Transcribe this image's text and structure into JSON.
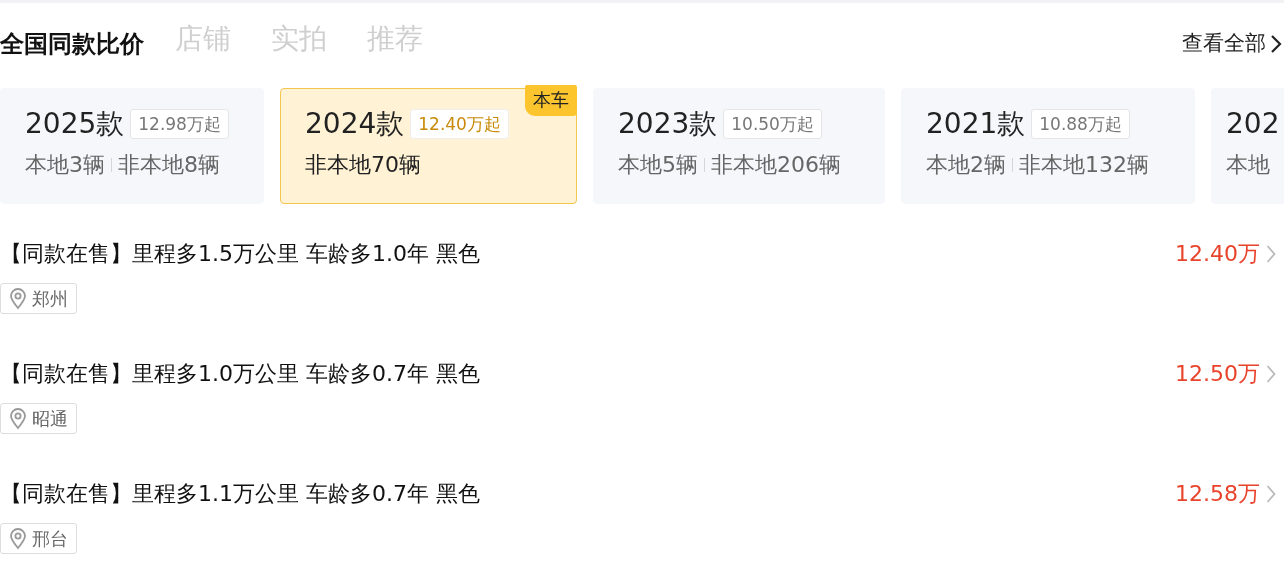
{
  "tabs": [
    {
      "label": "店铺"
    },
    {
      "label": "实拍"
    },
    {
      "label": "推荐"
    }
  ],
  "header": {
    "title": "全国同款比价",
    "view_all": "查看全部"
  },
  "versions": [
    {
      "year": "2025款",
      "price": "12.98万起",
      "stats": [
        "本地3辆",
        "非本地8辆"
      ],
      "selected": false
    },
    {
      "year": "2024款",
      "price": "12.40万起",
      "stats": [
        "非本地70辆"
      ],
      "selected": true,
      "badge": "本车"
    },
    {
      "year": "2023款",
      "price": "10.50万起",
      "stats": [
        "本地5辆",
        "非本地206辆"
      ],
      "selected": false
    },
    {
      "year": "2021款",
      "price": "10.88万起",
      "stats": [
        "本地2辆",
        "非本地132辆"
      ],
      "selected": false
    },
    {
      "year": "202",
      "stats": [
        "本地"
      ],
      "selected": false
    }
  ],
  "listings": [
    {
      "title": "【同款在售】里程多1.5万公里 车龄多1.0年 黑色",
      "price": "12.40万",
      "city": "郑州"
    },
    {
      "title": "【同款在售】里程多1.0万公里 车龄多0.7年 黑色",
      "price": "12.50万",
      "city": "昭通"
    },
    {
      "title": "【同款在售】里程多1.1万公里 车龄多0.7年 黑色",
      "price": "12.58万",
      "city": "邢台"
    }
  ]
}
